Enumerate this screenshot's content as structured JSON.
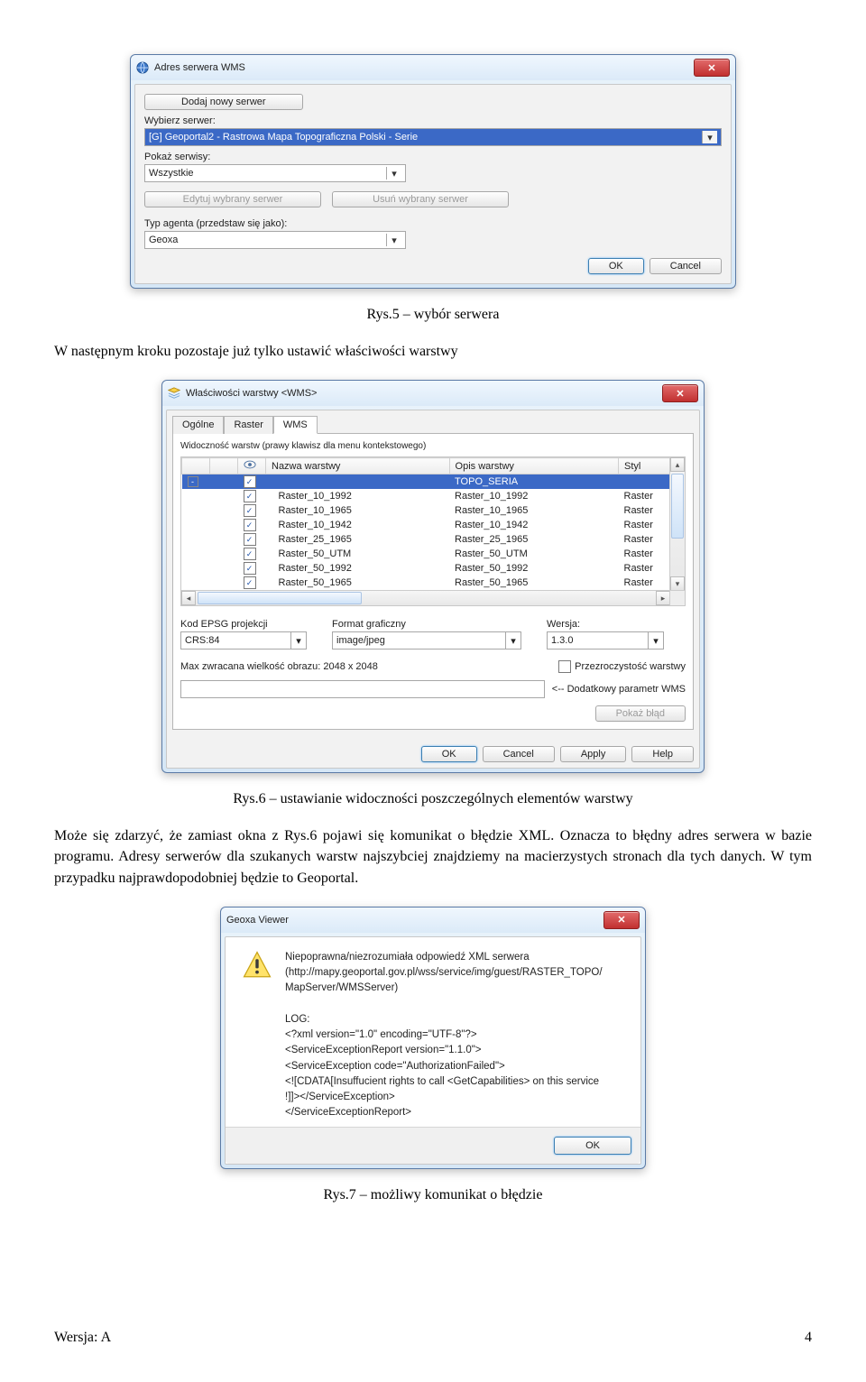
{
  "caption1": "Rys.5 – wybór serwera",
  "para1": "W następnym kroku pozostaje już tylko ustawić właściwości warstwy",
  "caption2": "Rys.6 – ustawianie widoczności poszczególnych elementów warstwy",
  "para2": "Może się zdarzyć, że zamiast okna z Rys.6 pojawi się komunikat o błędzie XML. Oznacza to błędny adres serwera w bazie programu. Adresy serwerów dla szukanych warstw najszybciej znajdziemy na macierzystych stronach dla tych danych. W tym przypadku najprawdopodobniej będzie to Geoportal.",
  "caption3": "Rys.7 – możliwy komunikat o błędzie",
  "footer_left": "Wersja: A",
  "footer_right": "4",
  "dlg1": {
    "title": "Adres serwera WMS",
    "add_btn": "Dodaj nowy serwer",
    "pick_label": "Wybierz serwer:",
    "pick_value": "[G] Geoportal2 - Rastrowa Mapa Topograficzna Polski - Serie",
    "show_label": "Pokaż serwisy:",
    "show_value": "Wszystkie",
    "edit_btn": "Edytuj wybrany serwer",
    "del_btn": "Usuń wybrany serwer",
    "agent_label": "Typ agenta (przedstaw się jako):",
    "agent_value": "Geoxa",
    "ok": "OK",
    "cancel": "Cancel"
  },
  "dlg2": {
    "title": "Właściwości warstwy <WMS>",
    "tabs": [
      "Ogólne",
      "Raster",
      "WMS"
    ],
    "hint": "Widoczność warstw (prawy klawisz dla menu kontekstowego)",
    "cols": {
      "name": "Nazwa warstwy",
      "desc": "Opis warstwy",
      "style": "Styl"
    },
    "eye_icon": "eye-icon",
    "rows": [
      {
        "indent": 0,
        "toggle": "-",
        "name": "",
        "desc": "TOPO_SERIA",
        "style": "",
        "selected": true
      },
      {
        "indent": 1,
        "name": "Raster_10_1992",
        "desc": "Raster_10_1992",
        "style": "Raster"
      },
      {
        "indent": 1,
        "name": "Raster_10_1965",
        "desc": "Raster_10_1965",
        "style": "Raster"
      },
      {
        "indent": 1,
        "name": "Raster_10_1942",
        "desc": "Raster_10_1942",
        "style": "Raster"
      },
      {
        "indent": 1,
        "name": "Raster_25_1965",
        "desc": "Raster_25_1965",
        "style": "Raster"
      },
      {
        "indent": 1,
        "name": "Raster_50_UTM",
        "desc": "Raster_50_UTM",
        "style": "Raster"
      },
      {
        "indent": 1,
        "name": "Raster_50_1992",
        "desc": "Raster_50_1992",
        "style": "Raster"
      },
      {
        "indent": 1,
        "name": "Raster_50_1965",
        "desc": "Raster_50_1965",
        "style": "Raster"
      }
    ],
    "proj_label": "Kod EPSG projekcji",
    "proj_value": "CRS:84",
    "fmt_label": "Format graficzny",
    "fmt_value": "image/jpeg",
    "ver_label": "Wersja:",
    "ver_value": "1.3.0",
    "max_label": "Max zwracana wielkość obrazu: 2048 x 2048",
    "transp_label": "Przezroczystość warstwy",
    "extra_param": "<-- Dodatkowy parametr WMS",
    "show_err_btn": "Pokaż błąd",
    "ok": "OK",
    "cancel": "Cancel",
    "apply": "Apply",
    "help": "Help"
  },
  "dlg3": {
    "title": "Geoxa Viewer",
    "lines": [
      "Niepoprawna/niezrozumiała odpowiedź XML serwera",
      "(http://mapy.geoportal.gov.pl/wss/service/img/guest/RASTER_TOPO/",
      "MapServer/WMSServer)",
      "",
      "LOG:",
      "<?xml version=\"1.0\" encoding=\"UTF-8\"?>",
      "<ServiceExceptionReport version=\"1.1.0\">",
      "<ServiceException code=\"AuthorizationFailed\">",
      "<![CDATA[Insuffucient rights to call <GetCapabilities> on this service",
      "!]]></ServiceException>",
      "</ServiceExceptionReport>"
    ],
    "ok": "OK"
  }
}
